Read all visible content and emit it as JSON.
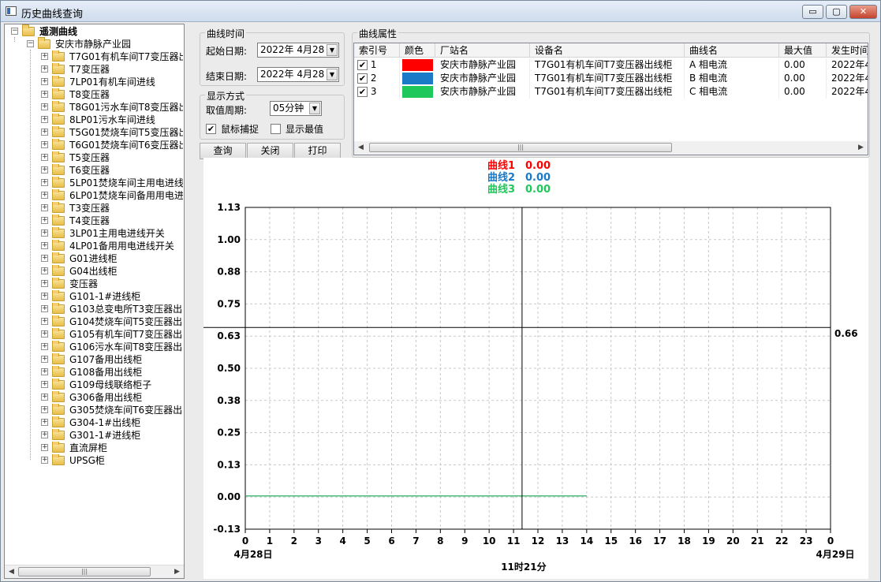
{
  "window": {
    "title": "历史曲线查询",
    "min_glyph": "▭",
    "max_glyph": "▢",
    "close_glyph": "✕"
  },
  "tree": {
    "root_label": "遥测曲线",
    "station_label": "安庆市静脉产业园",
    "items": [
      "T7G01有机车间T7变压器出",
      "T7变压器",
      "7LP01有机车间进线",
      "T8变压器",
      "T8G01污水车间T8变压器出",
      "8LP01污水车间进线",
      "T5G01焚烧车间T5变压器出",
      "T6G01焚烧车间T6变压器出",
      "T5变压器",
      "T6变压器",
      "5LP01焚烧车间主用电进线",
      "6LP01焚烧车间备用用电进",
      "T3变压器",
      "T4变压器",
      "3LP01主用电进线开关",
      "4LP01备用用电进线开关",
      "G01进线柜",
      "G04出线柜",
      "变压器",
      "G101-1#进线柜",
      "G103总变电所T3变压器出",
      "G104焚烧车间T5变压器出",
      "G105有机车间T7变压器出",
      "G106污水车间T8变压器出",
      "G107备用出线柜",
      "G108备用出线柜",
      "G109母线联络柜子",
      "G306备用出线柜",
      "G305焚烧车间T6变压器出",
      "G304-1#出线柜",
      "G301-1#进线柜",
      "直流屏柜",
      "UPSG柜"
    ]
  },
  "time_group": {
    "title": "曲线时间",
    "start_label": "起始日期:",
    "start_value": "2022年 4月28",
    "end_label": "结束日期:",
    "end_value": "2022年 4月28"
  },
  "display_group": {
    "title": "显示方式",
    "period_label": "取值周期:",
    "period_value": "05分钟",
    "capture_label": "鼠标捕捉",
    "capture_checked": true,
    "show_max_label": "显示最值",
    "show_max_checked": false
  },
  "buttons": {
    "query": "查询",
    "close": "关闭",
    "print": "打印"
  },
  "curve_props": {
    "title": "曲线属性",
    "columns": [
      "索引号",
      "颜色",
      "厂站名",
      "设备名",
      "曲线名",
      "最大值",
      "发生时间"
    ],
    "rows": [
      {
        "index": "1",
        "color": "#ff0000",
        "station": "安庆市静脉产业园",
        "device": "T7G01有机车间T7变压器出线柜",
        "curve": "A 相电流",
        "max": "0.00",
        "time": "2022年4"
      },
      {
        "index": "2",
        "color": "#1a7ac8",
        "station": "安庆市静脉产业园",
        "device": "T7G01有机车间T7变压器出线柜",
        "curve": "B 相电流",
        "max": "0.00",
        "time": "2022年4"
      },
      {
        "index": "3",
        "color": "#1fc85a",
        "station": "安庆市静脉产业园",
        "device": "T7G01有机车间T7变压器出线柜",
        "curve": "C 相电流",
        "max": "0.00",
        "time": "2022年4"
      }
    ]
  },
  "chart_data": {
    "type": "line",
    "legend": [
      {
        "name": "曲线1",
        "value": "0.00",
        "color": "#ff0000"
      },
      {
        "name": "曲线2",
        "value": "0.00",
        "color": "#1a7ac8"
      },
      {
        "name": "曲线3",
        "value": "0.00",
        "color": "#1fc85a"
      }
    ],
    "y_ticks": [
      "1.13",
      "1.00",
      "0.88",
      "0.75",
      "0.63",
      "0.50",
      "0.38",
      "0.25",
      "0.13",
      "0.00",
      "-0.13"
    ],
    "ylim": [
      -0.13,
      1.13
    ],
    "x_ticks": [
      "0",
      "1",
      "2",
      "3",
      "4",
      "5",
      "6",
      "7",
      "8",
      "9",
      "10",
      "11",
      "12",
      "13",
      "14",
      "15",
      "16",
      "17",
      "18",
      "19",
      "20",
      "21",
      "22",
      "23",
      "0"
    ],
    "xlim": [
      0,
      24
    ],
    "x_start_label": "4月28日",
    "x_end_label": "4月29日",
    "cursor_time_label": "11时21分",
    "cursor_x": 11.35,
    "cursor_y": 0.66,
    "cursor_y_label": "0.66",
    "series": [
      {
        "name": "曲线1",
        "color": "#ff0000",
        "x": [
          0,
          14
        ],
        "y": [
          0,
          0
        ]
      },
      {
        "name": "曲线2",
        "color": "#1a7ac8",
        "x": [
          0,
          14
        ],
        "y": [
          0,
          0
        ]
      },
      {
        "name": "曲线3",
        "color": "#1fc85a",
        "x": [
          0,
          14
        ],
        "y": [
          0,
          0
        ]
      }
    ],
    "grid": true
  }
}
